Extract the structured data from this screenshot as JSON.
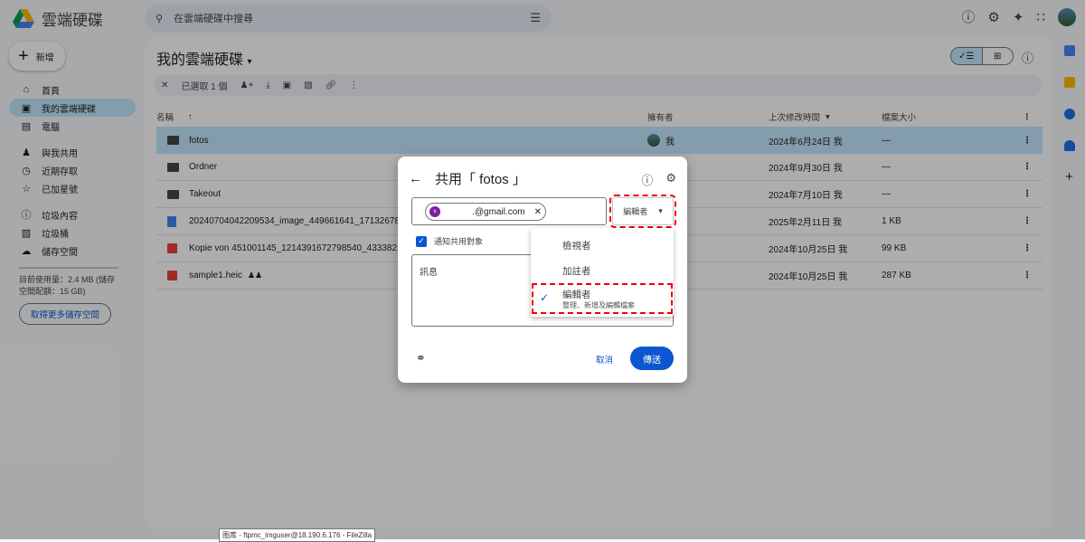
{
  "app": {
    "name": "雲端硬碟",
    "search_placeholder": "在雲端硬碟中搜尋"
  },
  "sidebar": {
    "new_label": "新增",
    "items": [
      {
        "label": "首頁",
        "icon": "home-icon"
      },
      {
        "label": "我的雲端硬碟",
        "icon": "drive-icon"
      },
      {
        "label": "電腦",
        "icon": "computer-icon"
      },
      {
        "label": "與我共用",
        "icon": "people-icon"
      },
      {
        "label": "近期存取",
        "icon": "clock-icon"
      },
      {
        "label": "已加星號",
        "icon": "star-icon"
      },
      {
        "label": "垃圾內容",
        "icon": "spam-icon"
      },
      {
        "label": "垃圾桶",
        "icon": "trash-icon"
      },
      {
        "label": "儲存空間",
        "icon": "cloud-icon"
      }
    ],
    "storage_text": "目前使用量：2.4 MB (儲存空間配額：15 GB)",
    "storage_button": "取得更多儲存空間"
  },
  "main": {
    "title": "我的雲端硬碟",
    "selected_count": "已選取 1 個",
    "columns": {
      "name": "名稱",
      "owner": "擁有者",
      "modified": "上次修改時間",
      "size": "檔案大小"
    },
    "rows": [
      {
        "name": "fotos",
        "type": "folder",
        "owner": "我",
        "modified": "2024年6月24日 我",
        "size": "—"
      },
      {
        "name": "Ordner",
        "type": "folder",
        "owner": "",
        "modified": "2024年9月30日 我",
        "size": "—"
      },
      {
        "name": "Takeout",
        "type": "folder",
        "owner": "",
        "modified": "2024年7月10日 我",
        "size": "—"
      },
      {
        "name": "20240704042209534_image_449661641_17132678861480",
        "type": "doc",
        "owner": "",
        "modified": "2025年2月11日 我",
        "size": "1 KB"
      },
      {
        "name": "Kopie von 451001145_1214391672798540_43338212773",
        "type": "image",
        "owner": "",
        "modified": "2024年10月25日 我",
        "size": "99 KB"
      },
      {
        "name": "sample1.heic",
        "type": "image",
        "shared": true,
        "owner": "",
        "modified": "2024年10月25日 我",
        "size": "287 KB"
      }
    ]
  },
  "dialog": {
    "title": "共用「 fotos 」",
    "recipient_initial": "x",
    "recipient_email": ".@gmail.com",
    "role": "編輯者",
    "notify_label": "通知共用對象",
    "message_placeholder": "訊息",
    "cancel": "取消",
    "send": "傳送",
    "roles": [
      {
        "label": "檢視者"
      },
      {
        "label": "加註者"
      },
      {
        "label": "編輯者",
        "desc": "整理、新增及編輯檔案",
        "selected": true
      }
    ]
  },
  "taskbar_tooltip": "图库 - ftpmc_imguser@18.190.6.176 - FileZilla"
}
